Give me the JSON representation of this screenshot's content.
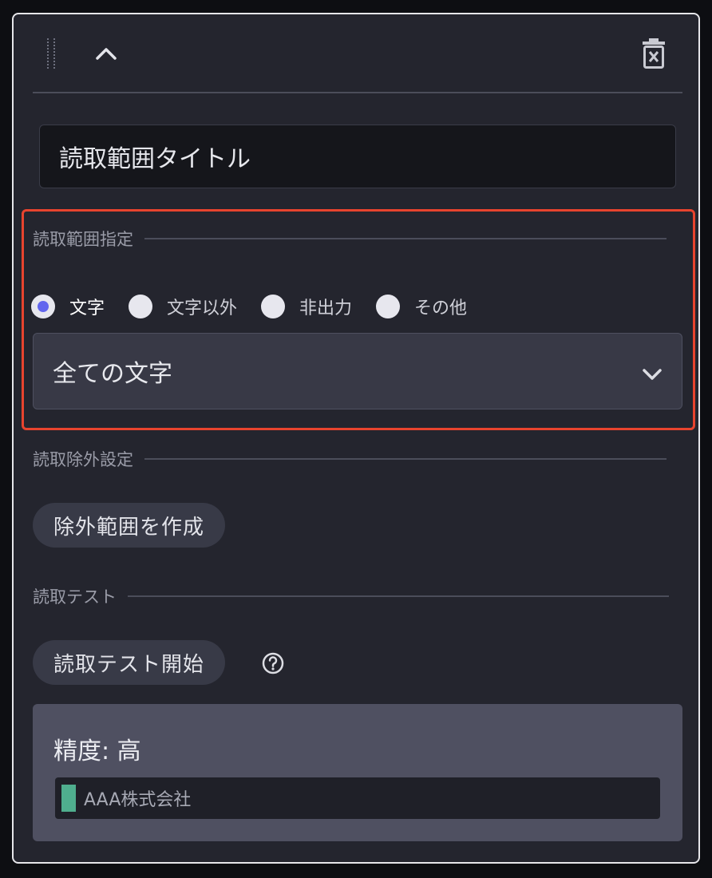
{
  "header": {
    "drag_icon": "drag-handle-icon",
    "collapse_icon": "chevron-up-icon",
    "delete_icon": "trash-icon"
  },
  "title_input": {
    "value": "読取範囲タイトル"
  },
  "range_section": {
    "heading": "読取範囲指定",
    "options": [
      {
        "label": "文字",
        "selected": true
      },
      {
        "label": "文字以外",
        "selected": false
      },
      {
        "label": "非出力",
        "selected": false
      },
      {
        "label": "その他",
        "selected": false
      }
    ],
    "select_value": "全ての文字",
    "select_icon": "chevron-down-icon"
  },
  "exclude_section": {
    "heading": "読取除外設定",
    "button_label": "除外範囲を作成"
  },
  "test_section": {
    "heading": "読取テスト",
    "button_label": "読取テスト開始",
    "help_icon": "help-circle-icon"
  },
  "result": {
    "accuracy": "精度: 高",
    "text": "AAA株式会社"
  },
  "colors": {
    "highlight": "#e8442e",
    "radio_selected": "#6266ee",
    "result_swatch": "#4fae8e"
  }
}
